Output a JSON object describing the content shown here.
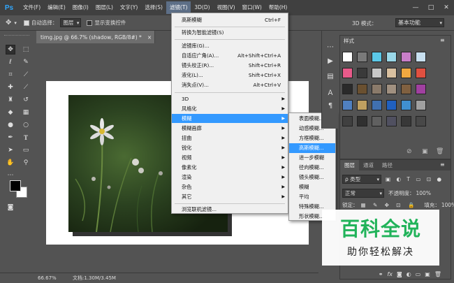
{
  "menubar": {
    "logo": "Ps",
    "items": [
      "文件(F)",
      "编辑(E)",
      "图像(I)",
      "图层(L)",
      "文字(Y)",
      "选择(S)",
      "滤镜(T)",
      "3D(D)",
      "视图(V)",
      "窗口(W)",
      "帮助(H)"
    ],
    "active_index": 6,
    "window_controls": [
      "—",
      "□",
      "✕"
    ]
  },
  "options": {
    "auto_select_label": "自动选择：",
    "auto_select_value": "图层",
    "show_transform_label": "显示变换控件",
    "mode_3d_label": "3D 模式：",
    "workspace_value": "基本功能"
  },
  "document": {
    "tab_title": "timg.jpg @ 66.7% (shadow, RGB/8#) *",
    "close": "×",
    "zoom": "66.67%",
    "info": "文档:1.30M/3.45M"
  },
  "filter_menu": {
    "items": [
      {
        "label": "高斯模糊",
        "shortcut": "Ctrl+F"
      },
      {
        "label": "转换为智能滤镜(S)",
        "shortcut": ""
      },
      {
        "label": "滤镜库(G)...",
        "shortcut": ""
      },
      {
        "label": "自适应广角(A)...",
        "shortcut": "Alt+Shift+Ctrl+A"
      },
      {
        "label": "镜头校正(R)...",
        "shortcut": "Shift+Ctrl+R"
      },
      {
        "label": "液化(L)...",
        "shortcut": "Shift+Ctrl+X"
      },
      {
        "label": "消失点(V)...",
        "shortcut": "Alt+Ctrl+V"
      },
      {
        "label": "3D",
        "shortcut": ""
      },
      {
        "label": "风格化",
        "shortcut": ""
      },
      {
        "label": "模糊",
        "shortcut": ""
      },
      {
        "label": "模糊画廊",
        "shortcut": ""
      },
      {
        "label": "扭曲",
        "shortcut": ""
      },
      {
        "label": "锐化",
        "shortcut": ""
      },
      {
        "label": "视频",
        "shortcut": ""
      },
      {
        "label": "像素化",
        "shortcut": ""
      },
      {
        "label": "渲染",
        "shortcut": ""
      },
      {
        "label": "杂色",
        "shortcut": ""
      },
      {
        "label": "其它",
        "shortcut": ""
      },
      {
        "label": "浏览联机滤镜...",
        "shortcut": ""
      }
    ],
    "arrow": "▶"
  },
  "blur_menu": {
    "items": [
      "表面模糊...",
      "动感模糊...",
      "方框模糊...",
      "高斯模糊...",
      "进一步模糊",
      "径向模糊...",
      "镜头模糊...",
      "模糊",
      "平均",
      "特殊模糊...",
      "形状模糊..."
    ],
    "highlighted_index": 3
  },
  "styles_panel": {
    "tab": "样式",
    "swatch_colors": [
      "#ffffff",
      "#7a7a7a",
      "#5bc8e8",
      "#9ad8e8",
      "#c87ec8",
      "#c8e0f0",
      "#e85a8a",
      "#3a3a3a",
      "#c8c8c8",
      "#d8c0a0",
      "#f0a840",
      "#e05040",
      "#2a2a2a",
      "#6a5030",
      "#8a7a6a",
      "#a09080",
      "#806040",
      "#a040a0",
      "#5080c0",
      "#c0a060",
      "#4070b0",
      "#2060c0",
      "#4090d0",
      "#a0a0a0",
      "#404040",
      "#303030",
      "#606060",
      "#505060",
      "#383838",
      "#484848"
    ]
  },
  "dock": {
    "icons": [
      "⋯",
      "▶",
      "▤",
      "Ａ",
      "¶"
    ]
  },
  "layers_panel": {
    "tabs": [
      "图层",
      "通道",
      "路径"
    ],
    "active_tab": 0,
    "kind_filter": "ρ 类型",
    "blend_mode": "正常",
    "opacity_label": "不透明度：",
    "opacity_value": "100%",
    "lock_label": "锁定：",
    "fill_label": "填充：",
    "fill_value": "100%"
  },
  "watermark": {
    "title": "百科全说",
    "subtitle": "助你轻松解决"
  }
}
